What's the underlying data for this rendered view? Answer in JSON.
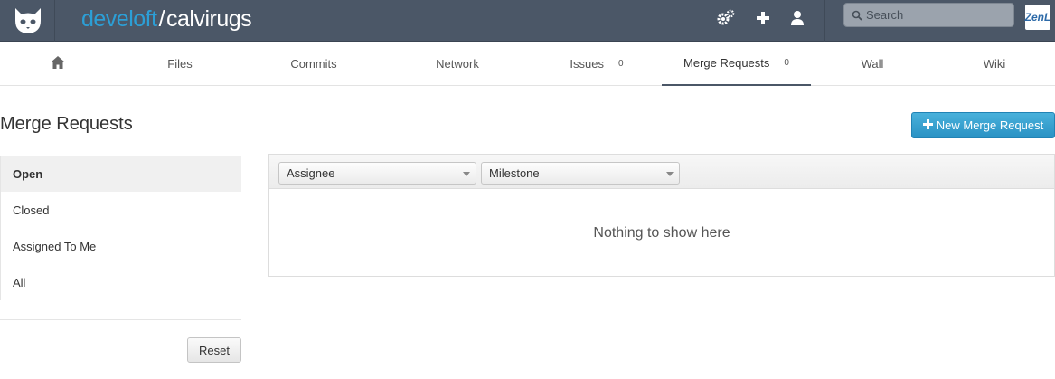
{
  "header": {
    "namespace": "develoft",
    "separator": "/",
    "project": "calvirugs",
    "search": {
      "placeholder": "Search",
      "value": ""
    },
    "avatar_text": "ZenL",
    "icons": [
      "logo-cat-icon",
      "admin-gears-icon",
      "new-plus-icon",
      "profile-user-icon",
      "search-icon"
    ]
  },
  "nav": {
    "tabs": [
      {
        "label": "",
        "icon": "home-icon"
      },
      {
        "label": "Files"
      },
      {
        "label": "Commits"
      },
      {
        "label": "Network"
      },
      {
        "label": "Issues",
        "count": "0"
      },
      {
        "label": "Merge Requests",
        "count": "0",
        "active": true
      },
      {
        "label": "Wall"
      },
      {
        "label": "Wiki"
      }
    ]
  },
  "main": {
    "title": "Merge Requests",
    "new_button": "New Merge Request",
    "filters": [
      {
        "label": "Open",
        "active": true
      },
      {
        "label": "Closed"
      },
      {
        "label": "Assigned To Me"
      },
      {
        "label": "All"
      }
    ],
    "reset_label": "Reset",
    "assignee_select": "Assignee",
    "milestone_select": "Milestone",
    "empty_text": "Nothing to show here"
  },
  "colors": {
    "header_bg": "#4b5767",
    "namespace": "#2c9fd6",
    "primary_button": "#2da0d0"
  }
}
